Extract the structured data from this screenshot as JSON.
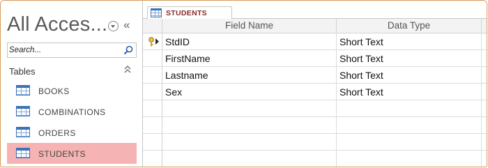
{
  "nav": {
    "title": "All Acces...",
    "shutter_glyph": "«",
    "search": {
      "placeholder": "Search..."
    },
    "group": {
      "label": "Tables"
    },
    "items": [
      {
        "label": "BOOKS",
        "selected": false
      },
      {
        "label": "COMBINATIONS",
        "selected": false
      },
      {
        "label": "ORDERS",
        "selected": false
      },
      {
        "label": "STUDENTS",
        "selected": true
      }
    ],
    "icons": {
      "menu": "circle-chevron-down-icon",
      "shutter": "double-chevron-left-icon",
      "search": "search-icon",
      "group_toggle": "double-chevron-up-icon",
      "item": "table-icon"
    }
  },
  "document": {
    "tab_label": "STUDENTS",
    "tab_icon": "table-icon",
    "columns": [
      "Field Name",
      "Data Type"
    ],
    "rows": [
      {
        "field_name": "StdID",
        "data_type": "Short Text",
        "primary_key": true
      },
      {
        "field_name": "FirstName",
        "data_type": "Short Text",
        "primary_key": false
      },
      {
        "field_name": "Lastname",
        "data_type": "Short Text",
        "primary_key": false
      },
      {
        "field_name": "Sex",
        "data_type": "Short Text",
        "primary_key": false
      },
      {
        "field_name": "",
        "data_type": "",
        "primary_key": false
      },
      {
        "field_name": "",
        "data_type": "",
        "primary_key": false
      },
      {
        "field_name": "",
        "data_type": "",
        "primary_key": false
      },
      {
        "field_name": "",
        "data_type": "",
        "primary_key": false
      }
    ]
  },
  "colors": {
    "window_border": "#d59b58",
    "selected_item": "#f5b3b3",
    "tab_text": "#8a2a2a",
    "table_icon_blue": "#3b72b8"
  }
}
